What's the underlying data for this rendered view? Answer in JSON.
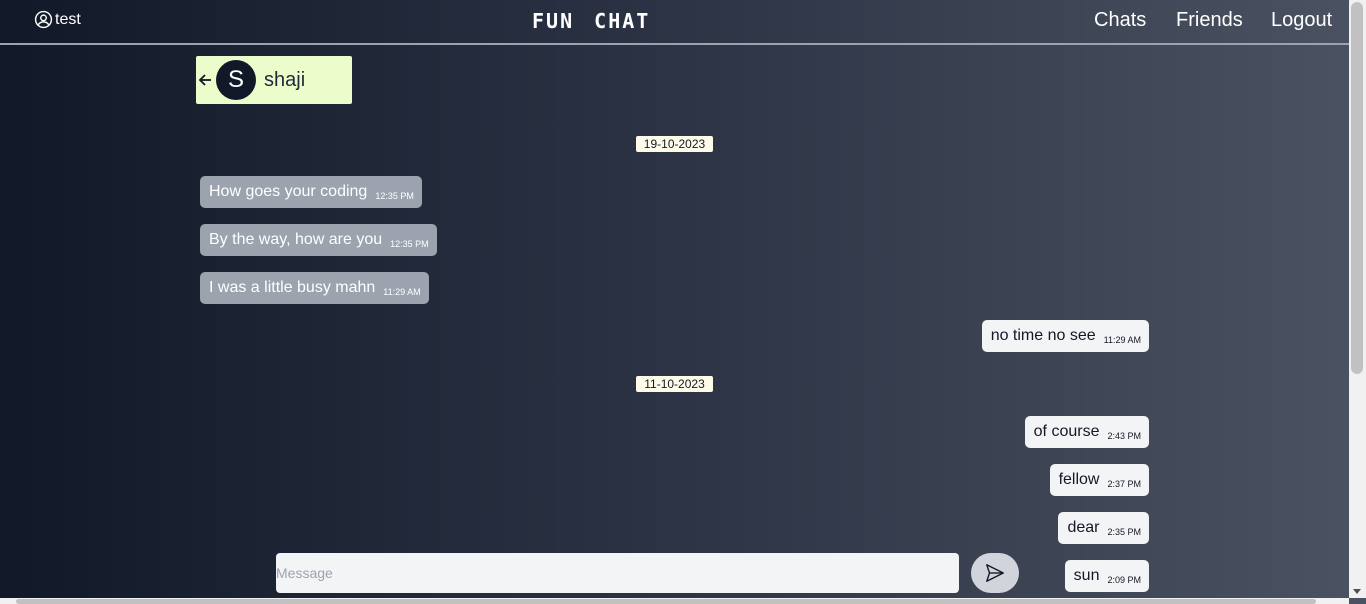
{
  "header": {
    "username": "test",
    "brand": "FUN CHAT",
    "nav": {
      "chats": "Chats",
      "friends": "Friends",
      "logout": "Logout"
    }
  },
  "contact": {
    "initial": "S",
    "name": "shaji"
  },
  "groups": [
    {
      "date": "19-10-2023",
      "messages": [
        {
          "side": "received",
          "text": "How goes your coding",
          "time": "12:35 PM"
        },
        {
          "side": "received",
          "text": "By the way, how are you",
          "time": "12:35 PM"
        },
        {
          "side": "received",
          "text": "I was a little busy mahn",
          "time": "11:29 AM"
        },
        {
          "side": "sent",
          "text": "no time no see",
          "time": "11:29 AM"
        }
      ]
    },
    {
      "date": "11-10-2023",
      "messages": [
        {
          "side": "sent",
          "text": "of course",
          "time": "2:43 PM"
        },
        {
          "side": "sent",
          "text": "fellow",
          "time": "2:37 PM"
        },
        {
          "side": "sent",
          "text": "dear",
          "time": "2:35 PM"
        },
        {
          "side": "sent",
          "text": "sun",
          "time": "2:09 PM"
        }
      ]
    }
  ],
  "composer": {
    "placeholder": "Message",
    "value": ""
  },
  "icons": {
    "user": "user-circle-icon",
    "back": "arrow-left-icon",
    "send": "paper-plane-icon"
  }
}
